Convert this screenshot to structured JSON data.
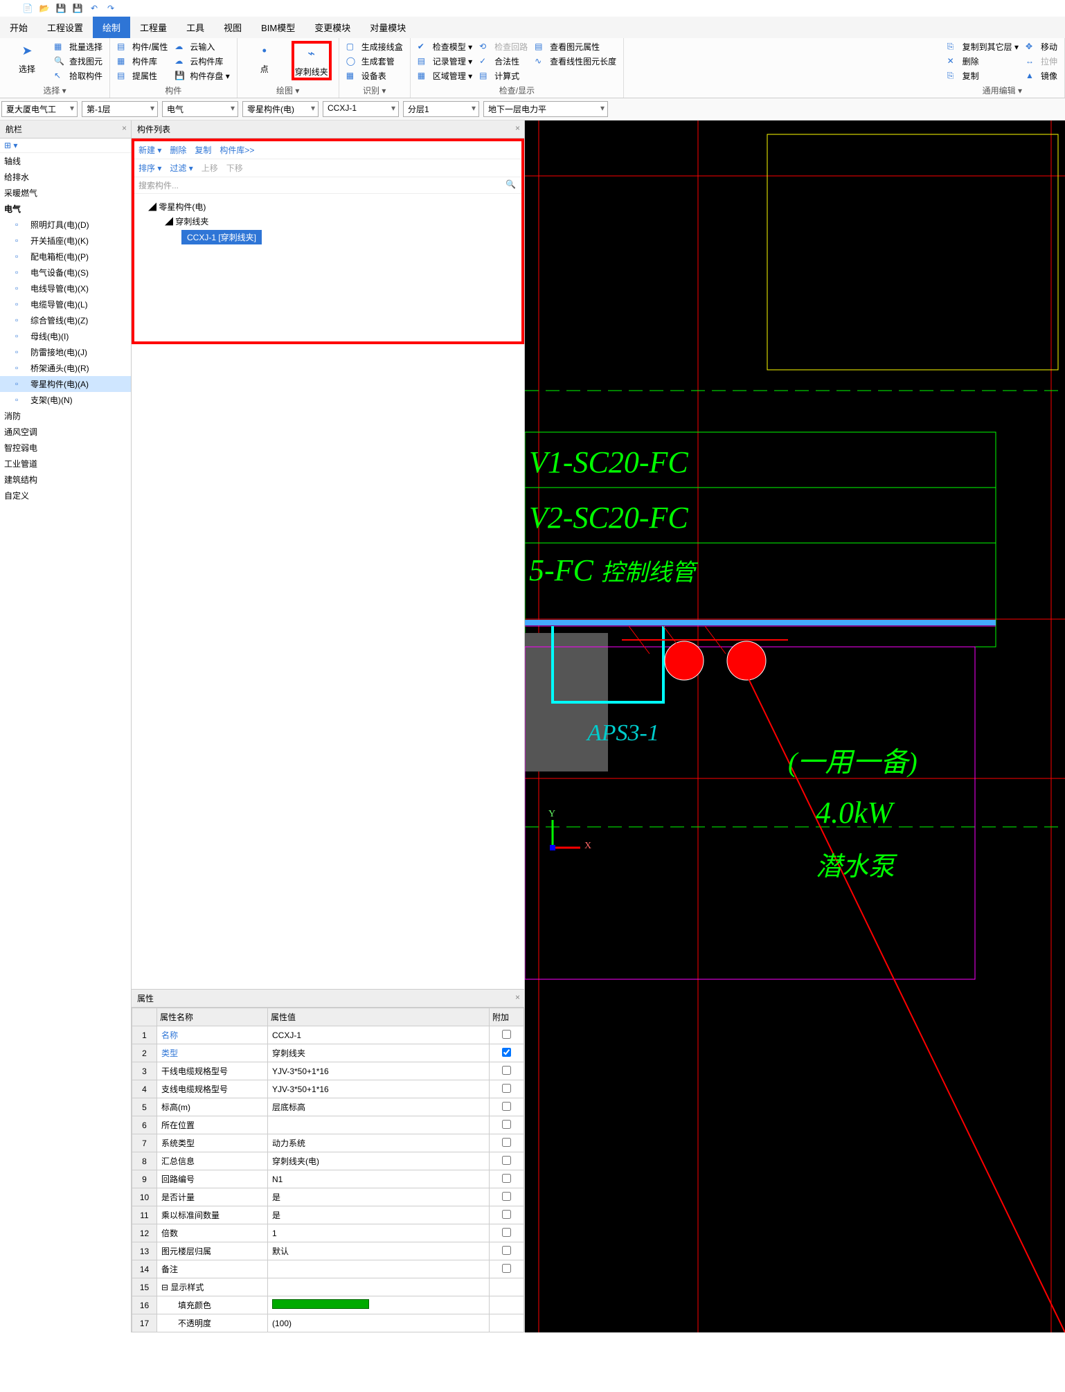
{
  "qat_icons": [
    "new",
    "open",
    "save",
    "saveall",
    "undo",
    "redo"
  ],
  "menubar": [
    "开始",
    "工程设置",
    "绘制",
    "工程量",
    "工具",
    "视图",
    "BIM模型",
    "变更模块",
    "对量模块"
  ],
  "menubar_active": 2,
  "ribbon": {
    "group1": {
      "label": "选择 ▾",
      "big": {
        "t": "选择"
      },
      "col": [
        "批量选择",
        "查找图元",
        "拾取构件"
      ]
    },
    "group2": {
      "label": "构件",
      "colA": [
        "构件/属性",
        "构件库",
        "提属性"
      ],
      "colB": [
        "云输入",
        "云构件库",
        "构件存盘 ▾"
      ]
    },
    "group3": {
      "label": "绘图 ▾",
      "big": {
        "t": "点"
      },
      "highlight": {
        "t": "穿刺线夹"
      }
    },
    "group4": {
      "label": "识别 ▾",
      "col": [
        "生成接线盒",
        "生成套管",
        "设备表"
      ]
    },
    "group5": {
      "label": "检查/显示",
      "colA": [
        "检查模型 ▾",
        "记录管理 ▾",
        "区域管理 ▾"
      ],
      "colB": [
        "检查回路",
        "合法性",
        "计算式"
      ],
      "colC": [
        "查看图元属性",
        "查看线性图元长度"
      ]
    },
    "group6": {
      "label": "通用编辑 ▾",
      "colA": [
        "复制到其它层 ▾",
        "删除",
        "复制"
      ],
      "colB": [
        "移动",
        "拉伸",
        "镜像"
      ]
    }
  },
  "selectbar": [
    "夏大厦电气工",
    "第-1层",
    "电气",
    "零星构件(电)",
    "CCXJ-1",
    "分层1",
    "地下一层电力平"
  ],
  "nav": {
    "head": "航栏",
    "cats": [
      "轴线",
      "给排水",
      "采暖燃气"
    ],
    "elec_head": "电气",
    "elec_items": [
      "照明灯具(电)(D)",
      "开关插座(电)(K)",
      "配电箱柜(电)(P)",
      "电气设备(电)(S)",
      "电线导管(电)(X)",
      "电缆导管(电)(L)",
      "综合管线(电)(Z)",
      "母线(电)(I)",
      "防雷接地(电)(J)",
      "桥架通头(电)(R)",
      "零星构件(电)(A)",
      "支架(电)(N)"
    ],
    "elec_active": 10,
    "tail": [
      "消防",
      "通风空调",
      "智控弱电",
      "工业管道",
      "建筑结构",
      "自定义"
    ]
  },
  "complist": {
    "head": "构件列表",
    "tb1": [
      "新建 ▾",
      "删除",
      "复制",
      "构件库>>"
    ],
    "tb2": [
      "排序 ▾",
      "过滤 ▾",
      "上移",
      "下移"
    ],
    "search_ph": "搜索构件...",
    "tree": {
      "n1": "零星构件(电)",
      "n2": "穿刺线夹",
      "n3": "CCXJ-1 [穿刺线夹]"
    }
  },
  "props": {
    "head": "属性",
    "cols": [
      "属性名称",
      "属性值",
      "附加"
    ],
    "rows": [
      {
        "i": 1,
        "n": "名称",
        "v": "CCXJ-1",
        "link": true
      },
      {
        "i": 2,
        "n": "类型",
        "v": "穿刺线夹",
        "link": true,
        "chk": true
      },
      {
        "i": 3,
        "n": "干线电缆规格型号",
        "v": "YJV-3*50+1*16"
      },
      {
        "i": 4,
        "n": "支线电缆规格型号",
        "v": "YJV-3*50+1*16"
      },
      {
        "i": 5,
        "n": "标高(m)",
        "v": "层底标高"
      },
      {
        "i": 6,
        "n": "所在位置",
        "v": ""
      },
      {
        "i": 7,
        "n": "系统类型",
        "v": "动力系统"
      },
      {
        "i": 8,
        "n": "汇总信息",
        "v": "穿刺线夹(电)"
      },
      {
        "i": 9,
        "n": "回路编号",
        "v": "N1"
      },
      {
        "i": 10,
        "n": "是否计量",
        "v": "是"
      },
      {
        "i": 11,
        "n": "乘以标准间数量",
        "v": "是"
      },
      {
        "i": 12,
        "n": "倍数",
        "v": "1"
      },
      {
        "i": 13,
        "n": "图元楼层归属",
        "v": "默认"
      },
      {
        "i": 14,
        "n": "备注",
        "v": ""
      },
      {
        "i": 15,
        "n": "显示样式",
        "v": "",
        "exp": true
      },
      {
        "i": 16,
        "n": "　　填充颜色",
        "v": "__color__"
      },
      {
        "i": 17,
        "n": "　　不透明度",
        "v": "(100)"
      }
    ]
  },
  "cad": {
    "t1": "V1-SC20-FC",
    "t2": "V2-SC20-FC",
    "t3": "5-FC",
    "t3b": "控制线管",
    "t4": "APS3-1",
    "t5": "(一用一备)",
    "t6": "4.0kW",
    "t7": "潜水泵",
    "axis_x": "X",
    "axis_y": "Y"
  }
}
